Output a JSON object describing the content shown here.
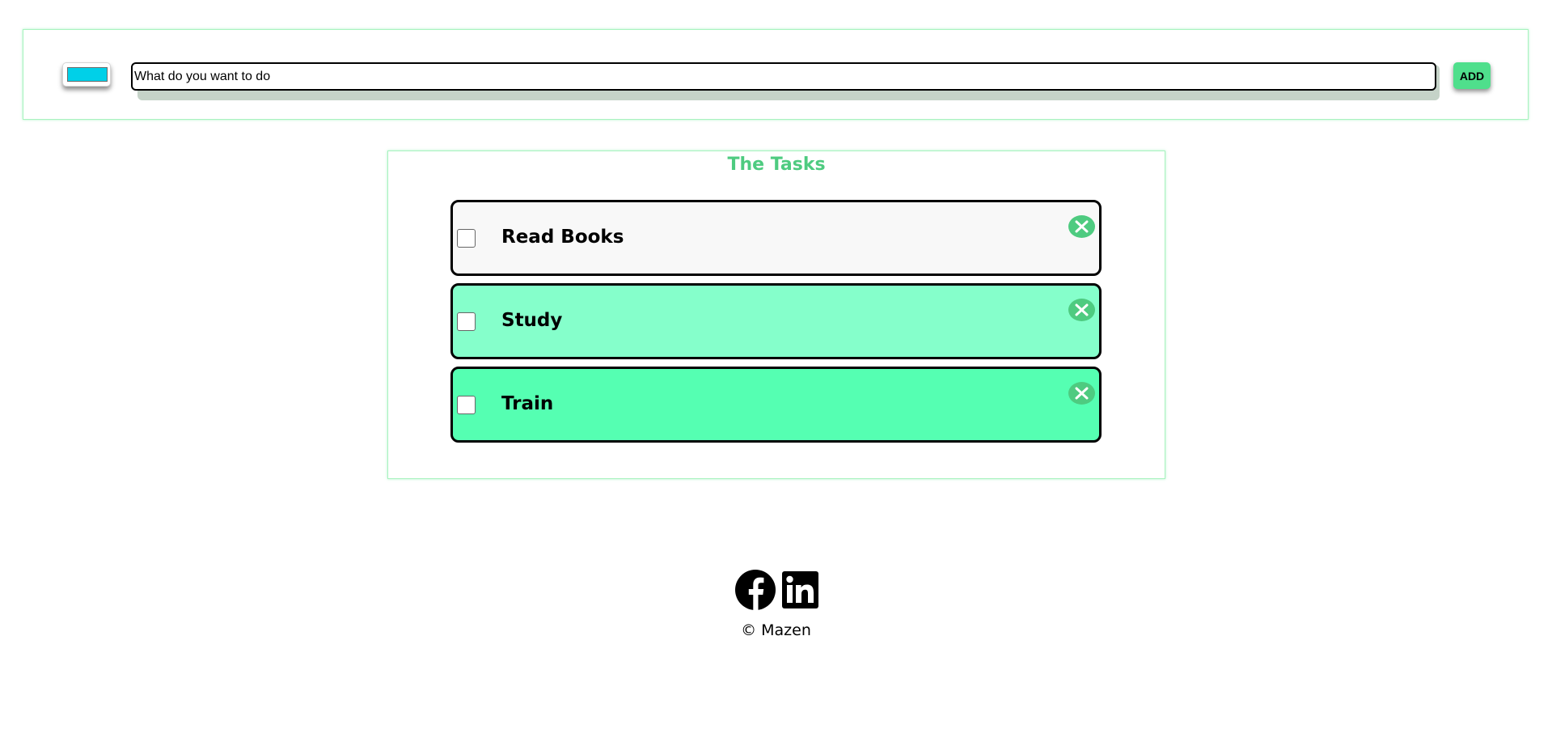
{
  "input_bar": {
    "color_value": "#00d0e8",
    "placeholder": "What do you want to do",
    "add_label": "ADD"
  },
  "tasks": {
    "title": "The Tasks",
    "items": [
      {
        "label": "Read Books",
        "color": "#f8f8f8",
        "checked": false
      },
      {
        "label": "Study",
        "color": "#85ffcb",
        "checked": false
      },
      {
        "label": "Train",
        "color": "#55ffb2",
        "checked": false
      }
    ],
    "remove_icon": "close-icon"
  },
  "footer": {
    "social": [
      {
        "name": "facebook",
        "icon": "facebook-icon"
      },
      {
        "name": "linkedin",
        "icon": "linkedin-icon"
      }
    ],
    "copyright": "© Mazen"
  },
  "colors": {
    "accent": "#4ecb80",
    "panel_border": "#a8f3bf"
  }
}
